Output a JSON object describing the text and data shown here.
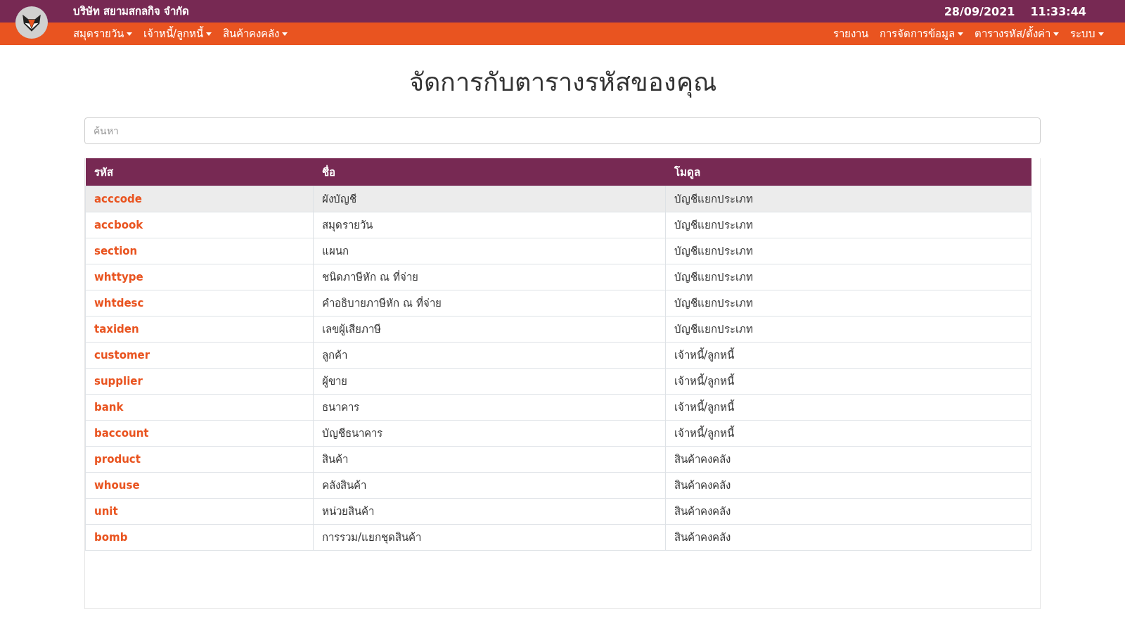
{
  "header": {
    "company": "บริษัท สยามสกลกิจ จำกัด",
    "date": "28/09/2021",
    "time": "11:33:44"
  },
  "nav_left": [
    {
      "label": "สมุดรายวัน",
      "dropdown": true
    },
    {
      "label": "เจ้าหนี้/ลูกหนี้",
      "dropdown": true
    },
    {
      "label": "สินค้าคงคลัง",
      "dropdown": true
    }
  ],
  "nav_right": [
    {
      "label": "รายงาน",
      "dropdown": false
    },
    {
      "label": "การจัดการข้อมูล",
      "dropdown": true
    },
    {
      "label": "ตารางรหัส/ตั้งค่า",
      "dropdown": true
    },
    {
      "label": "ระบบ",
      "dropdown": true
    }
  ],
  "page_title": "จัดการกับตารางรหัสของคุณ",
  "search": {
    "placeholder": "ค้นหา"
  },
  "table": {
    "columns": [
      "รหัส",
      "ชื่อ",
      "โมดูล"
    ],
    "rows": [
      {
        "code": "acccode",
        "name": "ผังบัญชี",
        "module": "บัญชีแยกประเภท",
        "selected": true
      },
      {
        "code": "accbook",
        "name": "สมุดรายวัน",
        "module": "บัญชีแยกประเภท",
        "selected": false
      },
      {
        "code": "section",
        "name": "แผนก",
        "module": "บัญชีแยกประเภท",
        "selected": false
      },
      {
        "code": "whttype",
        "name": "ชนิดภาษีหัก ณ ที่จ่าย",
        "module": "บัญชีแยกประเภท",
        "selected": false
      },
      {
        "code": "whtdesc",
        "name": "คำอธิบายภาษีหัก ณ ที่จ่าย",
        "module": "บัญชีแยกประเภท",
        "selected": false
      },
      {
        "code": "taxiden",
        "name": "เลขผู้เสียภาษี",
        "module": "บัญชีแยกประเภท",
        "selected": false
      },
      {
        "code": "customer",
        "name": "ลูกค้า",
        "module": "เจ้าหนี้/ลูกหนี้",
        "selected": false
      },
      {
        "code": "supplier",
        "name": "ผู้ขาย",
        "module": "เจ้าหนี้/ลูกหนี้",
        "selected": false
      },
      {
        "code": "bank",
        "name": "ธนาคาร",
        "module": "เจ้าหนี้/ลูกหนี้",
        "selected": false
      },
      {
        "code": "baccount",
        "name": "บัญชีธนาคาร",
        "module": "เจ้าหนี้/ลูกหนี้",
        "selected": false
      },
      {
        "code": "product",
        "name": "สินค้า",
        "module": "สินค้าคงคลัง",
        "selected": false
      },
      {
        "code": "whouse",
        "name": "คลังสินค้า",
        "module": "สินค้าคงคลัง",
        "selected": false
      },
      {
        "code": "unit",
        "name": "หน่วยสินค้า",
        "module": "สินค้าคงคลัง",
        "selected": false
      },
      {
        "code": "bomb",
        "name": "การรวม/แยกชุดสินค้า",
        "module": "สินค้าคงคลัง",
        "selected": false
      }
    ]
  }
}
